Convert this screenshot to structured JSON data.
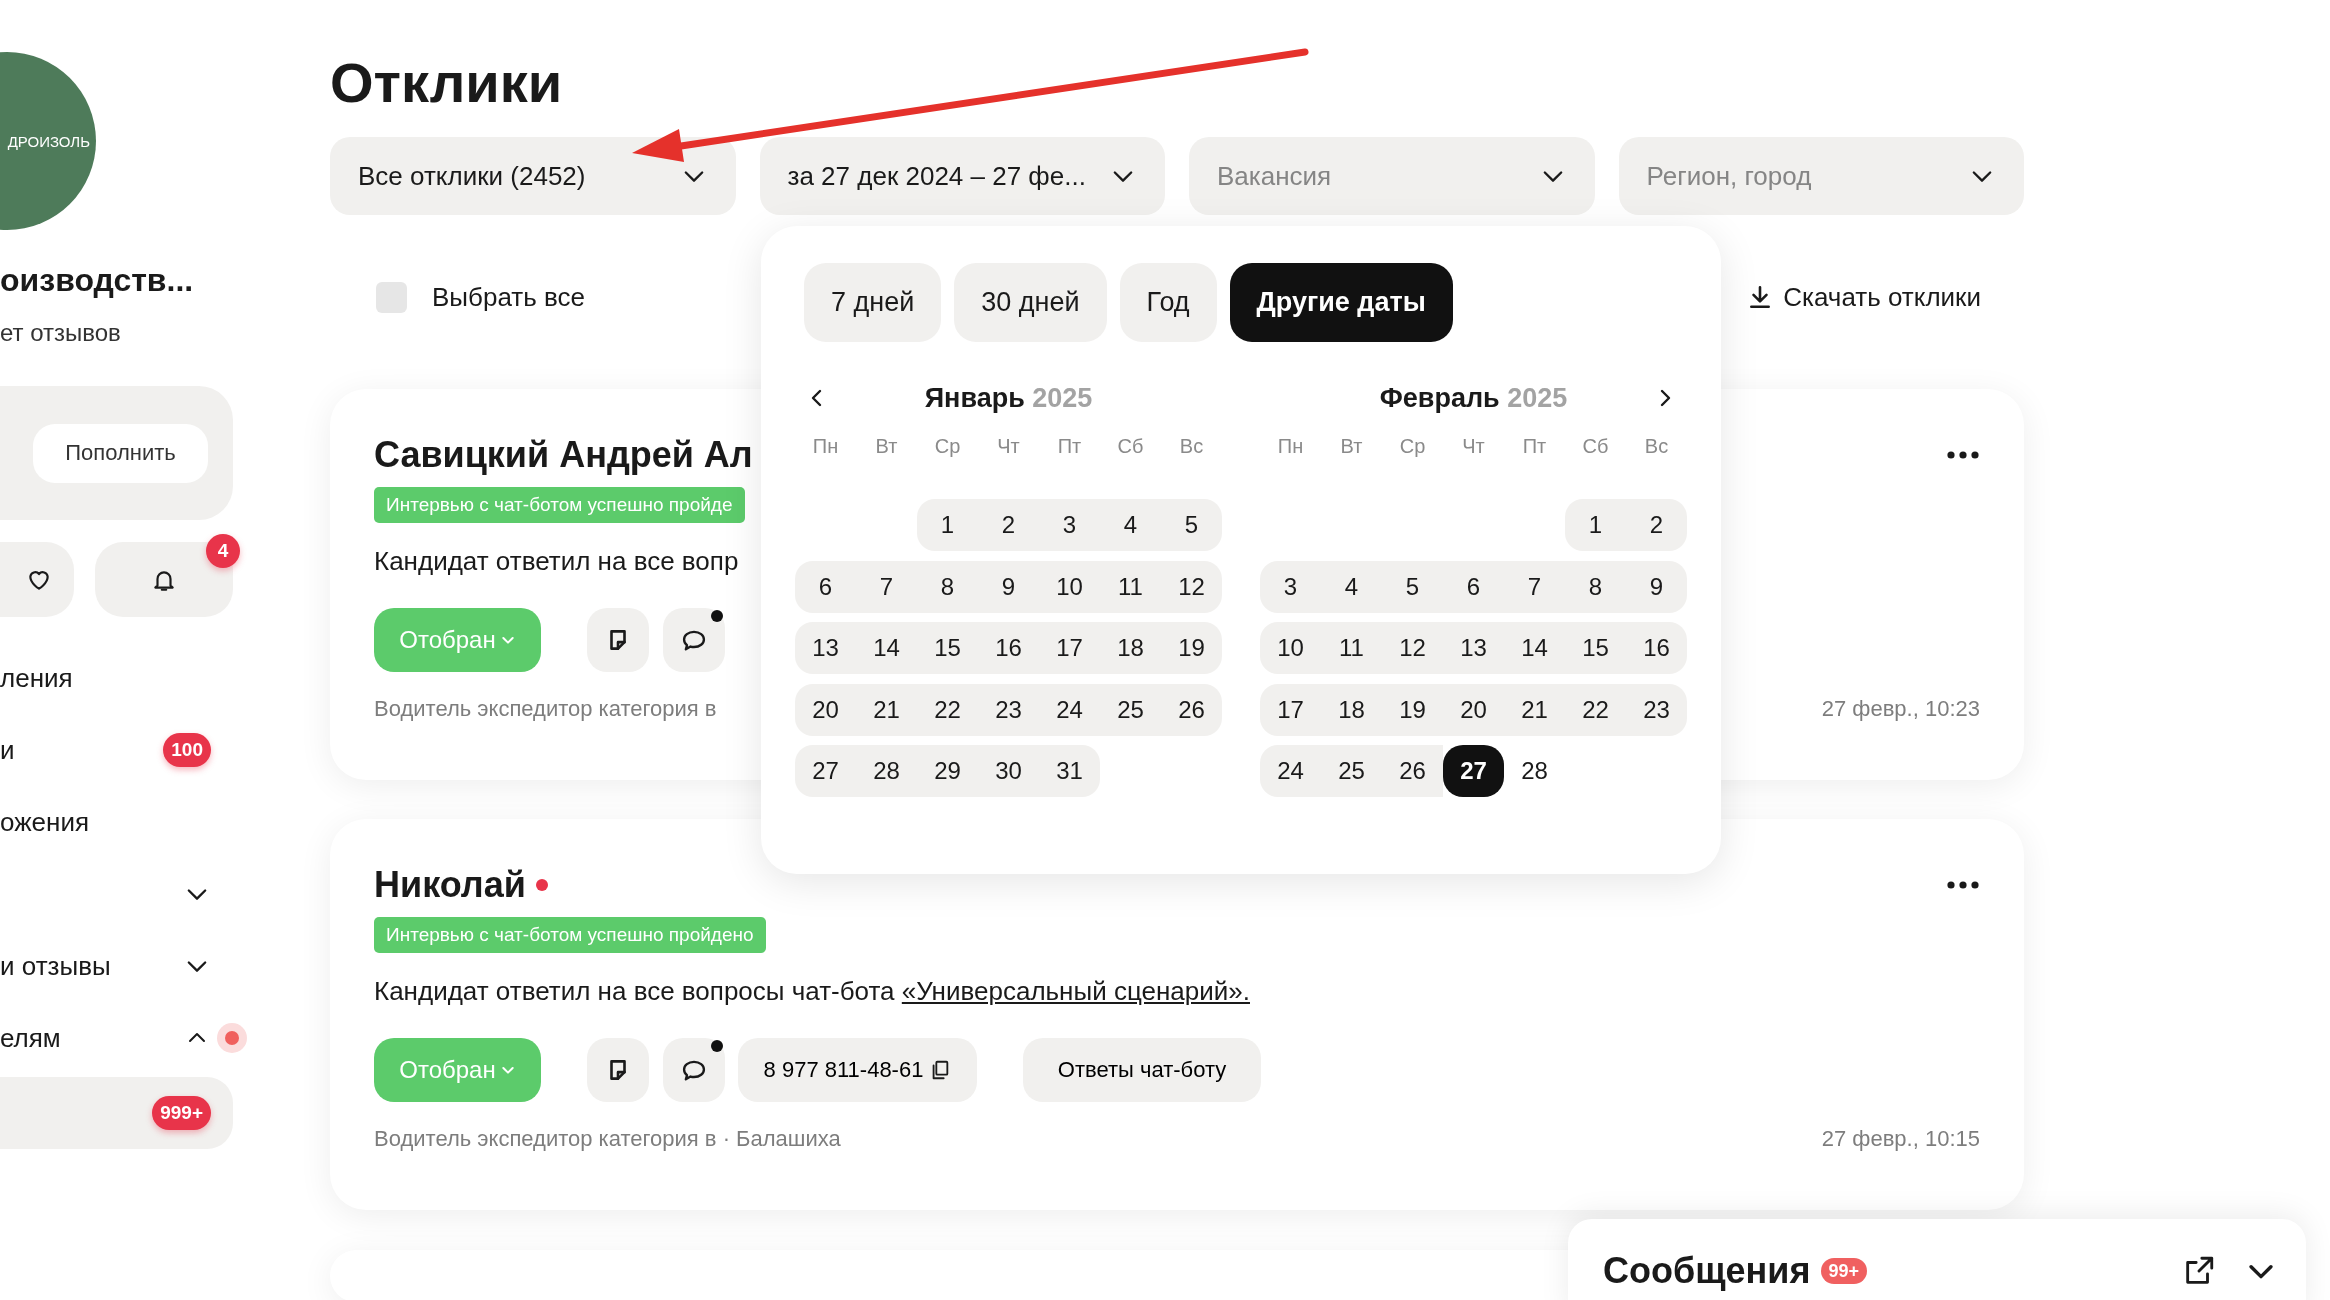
{
  "sidebar": {
    "logo_text": "ДРОИЗОЛЬ",
    "company_name": "оизводств...",
    "reviews": "ет отзывов",
    "topup_button": "Пополнить",
    "notifications_badge": "4",
    "nav": [
      {
        "kind": "link",
        "label": "ления"
      },
      {
        "kind": "link",
        "label": "и",
        "badge": "100"
      },
      {
        "kind": "link",
        "label": "ожения"
      },
      {
        "kind": "group",
        "expanded": false,
        "alert": false
      },
      {
        "kind": "group",
        "label": "и отзывы",
        "expanded": false,
        "alert": false
      },
      {
        "kind": "group",
        "label": "елям",
        "expanded": true,
        "alert": true
      },
      {
        "kind": "subitem",
        "badge": "999+"
      }
    ]
  },
  "title": "Отклики",
  "filters": [
    {
      "value": "Все отклики (2452)"
    },
    {
      "value": "за 27 дек 2024 – 27 фе..."
    },
    {
      "placeholder": "Вакансия"
    },
    {
      "placeholder": "Регион, город"
    }
  ],
  "select_all": {
    "label": "Выбрать все",
    "checked": false
  },
  "download": "Скачать отклики",
  "cards": [
    {
      "name": "Савицкий Андрей Ал",
      "unread": false,
      "tag": "Интервью с чат-ботом успешно пройде",
      "text": "Кандидат ответил на все вопр",
      "status": "Отобран",
      "chat_unread": true,
      "footer": "Водитель экспедитор категория в",
      "date": "27 февр., 10:23"
    },
    {
      "name": "Николай",
      "unread": true,
      "tag": "Интервью с чат-ботом успешно пройдено",
      "text": "Кандидат ответил на все вопросы чат-бота ",
      "link": "«Универсальный сценарий».",
      "status": "Отобран",
      "chat_unread": true,
      "phone": "8 977 811-48-61",
      "answers_button": "Ответы чат-боту",
      "footer": "Водитель экспедитор категория в · Балашиха",
      "date": "27 февр., 10:15"
    }
  ],
  "date_popup": {
    "presets": [
      {
        "label": "7 дней",
        "selected": false
      },
      {
        "label": "30 дней",
        "selected": false
      },
      {
        "label": "Год",
        "selected": false
      },
      {
        "label": "Другие даты",
        "selected": true
      }
    ],
    "months": [
      {
        "name": "Январь",
        "year": "2025",
        "weekdays": [
          "Пн",
          "Вт",
          "Ср",
          "Чт",
          "Пт",
          "Сб",
          "Вс"
        ],
        "weeks": [
          [
            {
              "kind": "empty"
            },
            {
              "kind": "empty"
            },
            {
              "kind": "day",
              "label": "1",
              "in_range": true,
              "selected": false
            },
            {
              "kind": "day",
              "label": "2",
              "in_range": true,
              "selected": false
            },
            {
              "kind": "day",
              "label": "3",
              "in_range": true,
              "selected": false
            },
            {
              "kind": "day",
              "label": "4",
              "in_range": true,
              "selected": false
            },
            {
              "kind": "day",
              "label": "5",
              "in_range": true,
              "selected": false
            }
          ],
          [
            {
              "kind": "day",
              "label": "6",
              "in_range": true,
              "selected": false
            },
            {
              "kind": "day",
              "label": "7",
              "in_range": true,
              "selected": false
            },
            {
              "kind": "day",
              "label": "8",
              "in_range": true,
              "selected": false
            },
            {
              "kind": "day",
              "label": "9",
              "in_range": true,
              "selected": false
            },
            {
              "kind": "day",
              "label": "10",
              "in_range": true,
              "selected": false
            },
            {
              "kind": "day",
              "label": "11",
              "in_range": true,
              "selected": false
            },
            {
              "kind": "day",
              "label": "12",
              "in_range": true,
              "selected": false
            }
          ],
          [
            {
              "kind": "day",
              "label": "13",
              "in_range": true,
              "selected": false
            },
            {
              "kind": "day",
              "label": "14",
              "in_range": true,
              "selected": false
            },
            {
              "kind": "day",
              "label": "15",
              "in_range": true,
              "selected": false
            },
            {
              "kind": "day",
              "label": "16",
              "in_range": true,
              "selected": false
            },
            {
              "kind": "day",
              "label": "17",
              "in_range": true,
              "selected": false
            },
            {
              "kind": "day",
              "label": "18",
              "in_range": true,
              "selected": false
            },
            {
              "kind": "day",
              "label": "19",
              "in_range": true,
              "selected": false
            }
          ],
          [
            {
              "kind": "day",
              "label": "20",
              "in_range": true,
              "selected": false
            },
            {
              "kind": "day",
              "label": "21",
              "in_range": true,
              "selected": false
            },
            {
              "kind": "day",
              "label": "22",
              "in_range": true,
              "selected": false
            },
            {
              "kind": "day",
              "label": "23",
              "in_range": true,
              "selected": false
            },
            {
              "kind": "day",
              "label": "24",
              "in_range": true,
              "selected": false
            },
            {
              "kind": "day",
              "label": "25",
              "in_range": true,
              "selected": false
            },
            {
              "kind": "day",
              "label": "26",
              "in_range": true,
              "selected": false
            }
          ],
          [
            {
              "kind": "day",
              "label": "27",
              "in_range": true,
              "selected": false
            },
            {
              "kind": "day",
              "label": "28",
              "in_range": true,
              "selected": false
            },
            {
              "kind": "day",
              "label": "29",
              "in_range": true,
              "selected": false
            },
            {
              "kind": "day",
              "label": "30",
              "in_range": true,
              "selected": false
            },
            {
              "kind": "day",
              "label": "31",
              "in_range": true,
              "selected": false
            }
          ]
        ]
      },
      {
        "name": "Февраль",
        "year": "2025",
        "weekdays": [
          "Пн",
          "Вт",
          "Ср",
          "Чт",
          "Пт",
          "Сб",
          "Вс"
        ],
        "weeks": [
          [
            {
              "kind": "empty"
            },
            {
              "kind": "empty"
            },
            {
              "kind": "empty"
            },
            {
              "kind": "empty"
            },
            {
              "kind": "empty"
            },
            {
              "kind": "day",
              "label": "1",
              "in_range": true,
              "selected": false
            },
            {
              "kind": "day",
              "label": "2",
              "in_range": true,
              "selected": false
            }
          ],
          [
            {
              "kind": "day",
              "label": "3",
              "in_range": true,
              "selected": false
            },
            {
              "kind": "day",
              "label": "4",
              "in_range": true,
              "selected": false
            },
            {
              "kind": "day",
              "label": "5",
              "in_range": true,
              "selected": false
            },
            {
              "kind": "day",
              "label": "6",
              "in_range": true,
              "selected": false
            },
            {
              "kind": "day",
              "label": "7",
              "in_range": true,
              "selected": false
            },
            {
              "kind": "day",
              "label": "8",
              "in_range": true,
              "selected": false
            },
            {
              "kind": "day",
              "label": "9",
              "in_range": true,
              "selected": false
            }
          ],
          [
            {
              "kind": "day",
              "label": "10",
              "in_range": true,
              "selected": false
            },
            {
              "kind": "day",
              "label": "11",
              "in_range": true,
              "selected": false
            },
            {
              "kind": "day",
              "label": "12",
              "in_range": true,
              "selected": false
            },
            {
              "kind": "day",
              "label": "13",
              "in_range": true,
              "selected": false
            },
            {
              "kind": "day",
              "label": "14",
              "in_range": true,
              "selected": false
            },
            {
              "kind": "day",
              "label": "15",
              "in_range": true,
              "selected": false
            },
            {
              "kind": "day",
              "label": "16",
              "in_range": true,
              "selected": false
            }
          ],
          [
            {
              "kind": "day",
              "label": "17",
              "in_range": true,
              "selected": false
            },
            {
              "kind": "day",
              "label": "18",
              "in_range": true,
              "selected": false
            },
            {
              "kind": "day",
              "label": "19",
              "in_range": true,
              "selected": false
            },
            {
              "kind": "day",
              "label": "20",
              "in_range": true,
              "selected": false
            },
            {
              "kind": "day",
              "label": "21",
              "in_range": true,
              "selected": false
            },
            {
              "kind": "day",
              "label": "22",
              "in_range": true,
              "selected": false
            },
            {
              "kind": "day",
              "label": "23",
              "in_range": true,
              "selected": false
            }
          ],
          [
            {
              "kind": "day",
              "label": "24",
              "in_range": true,
              "selected": false
            },
            {
              "kind": "day",
              "label": "25",
              "in_range": true,
              "selected": false
            },
            {
              "kind": "day",
              "label": "26",
              "in_range": true,
              "selected": false
            },
            {
              "kind": "day",
              "label": "27",
              "in_range": true,
              "selected": true
            },
            {
              "kind": "day",
              "label": "28",
              "in_range": false,
              "selected": false
            }
          ]
        ]
      }
    ]
  },
  "messages": {
    "title": "Сообщения",
    "badge": "99+"
  }
}
